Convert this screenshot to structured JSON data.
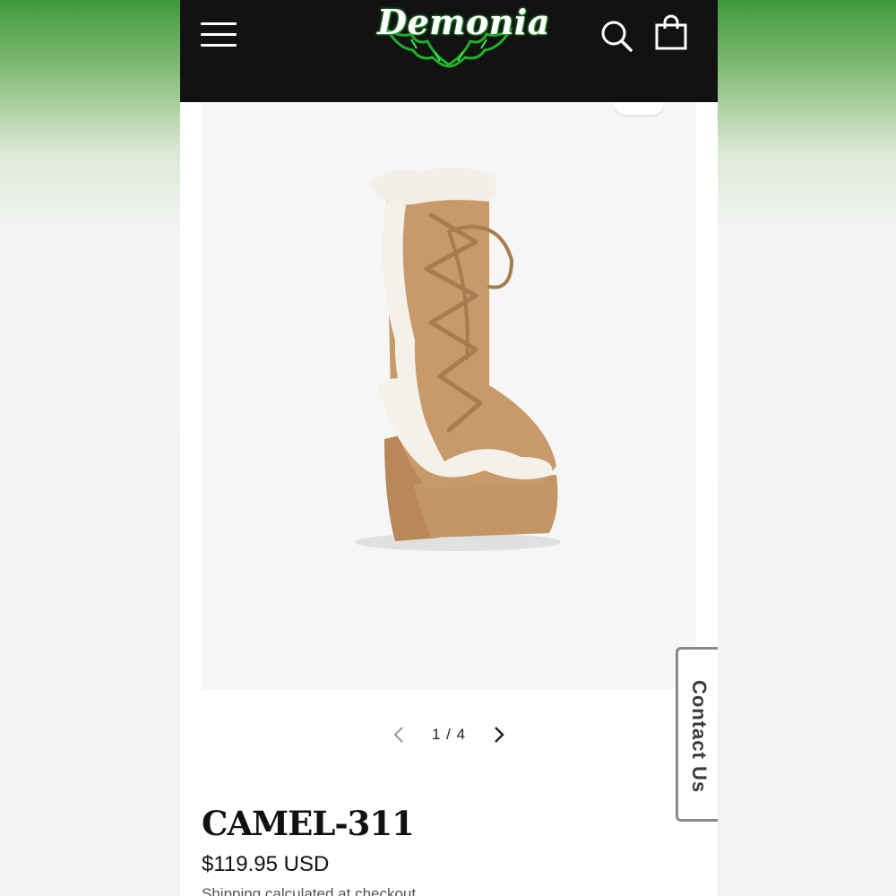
{
  "header": {
    "logo_text": "Demonia",
    "icons": [
      "hamburger-menu-icon",
      "search-icon",
      "shopping-bag-icon"
    ],
    "background_color": "#121212",
    "logo_accent_color": "#2ecc40"
  },
  "product": {
    "image_alt": "CAMEL-311 platform knee boot with faux fur trim",
    "title": "CAMEL-311",
    "price": "$119.95 USD",
    "shipping_note": "Shipping calculated at checkout"
  },
  "gallery": {
    "pager_text": "1 / 4",
    "prev_icon": "chevron-left-icon",
    "next_icon": "chevron-right-icon"
  },
  "contact": {
    "label": "Contact Us"
  }
}
